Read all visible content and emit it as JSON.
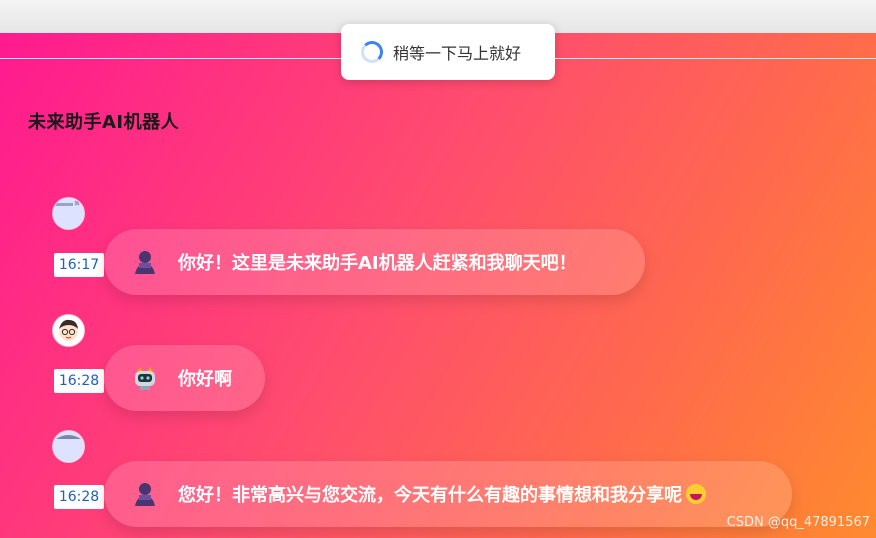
{
  "toast": {
    "text": "稍等一下马上就好",
    "icon": "spinner-icon"
  },
  "header": {
    "title": "未来助手AI机器人"
  },
  "messages": [
    {
      "time": "16:17",
      "text": "你好！这里是未来助手AI机器人赶紧和我聊天吧！",
      "avatar": "avatar-placeholder",
      "icon": "user-icon"
    },
    {
      "time": "16:28",
      "text": "你好啊",
      "avatar": "boy-face-avatar",
      "icon": "robot-icon"
    },
    {
      "time": "16:28",
      "text": "您好！非常高兴与您交流，今天有什么有趣的事情想和我分享呢",
      "avatar": "avatar-placeholder",
      "icon": "user-icon",
      "trailing_emoji": "grinning-emoji"
    }
  ],
  "watermark": "CSDN @qq_47891567",
  "colors": {
    "gradient_start": "#ff1a8f",
    "gradient_end": "#ff8a2e",
    "time_text": "#1f5fbf",
    "spinner": "#3b82f6"
  }
}
